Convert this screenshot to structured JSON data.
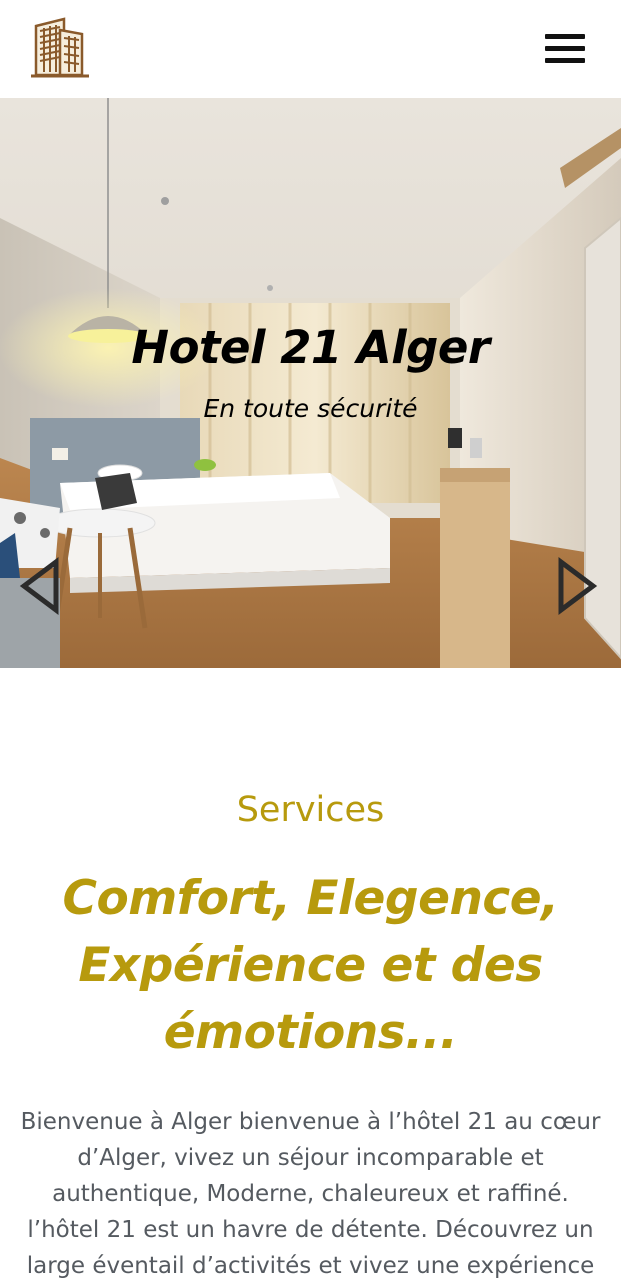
{
  "header": {
    "logo_icon": "hotel-building-logo",
    "menu_icon": "hamburger-menu-icon"
  },
  "hero": {
    "title": "Hotel 21 Alger",
    "subtitle": "En toute sécurité",
    "prev_icon": "chevron-left-icon",
    "next_icon": "chevron-right-icon"
  },
  "services": {
    "heading": "Services",
    "tagline": "Comfort, Elegence, Expérience et des émotions...",
    "intro": "Bienvenue à Alger bienvenue à l’hôtel 21 au cœur d’Alger, vivez un séjour incomparable et authentique, Moderne, chaleureux et raffiné. l’hôtel 21 est un havre de détente. Découvrez un large éventail d’activités et vivez une expérience"
  },
  "colors": {
    "accent_gold": "#b79a0d",
    "logo_brown": "#8a5a2b",
    "text_gray": "#555a60"
  }
}
